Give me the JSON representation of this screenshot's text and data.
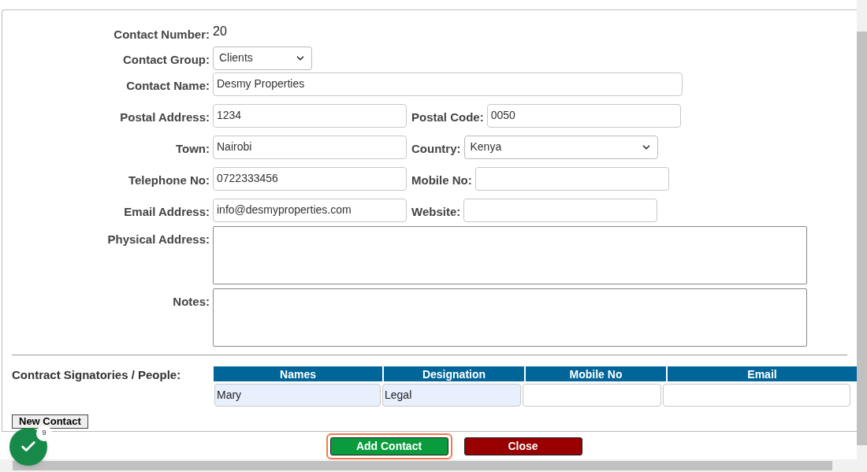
{
  "form": {
    "rows": [
      {
        "items": [
          {
            "label": "Contact Number:",
            "kind": "text",
            "value": "20"
          }
        ]
      },
      {
        "items": [
          {
            "label": "Contact Group:",
            "kind": "select",
            "value": "Clients"
          }
        ]
      },
      {
        "items": [
          {
            "label": "Contact Name:",
            "kind": "input",
            "value": "Desmy Properties"
          }
        ]
      },
      {
        "items": [
          {
            "label": "Postal Address:",
            "kind": "input",
            "value": "1234"
          },
          {
            "label": "Postal Code:",
            "kind": "input",
            "value": "0050"
          }
        ]
      },
      {
        "items": [
          {
            "label": "Town:",
            "kind": "input",
            "value": "Nairobi"
          },
          {
            "label": "Country:",
            "kind": "select",
            "value": "Kenya"
          }
        ]
      },
      {
        "items": [
          {
            "label": "Telephone No:",
            "kind": "input",
            "value": "0722333456"
          },
          {
            "label": "Mobile No:",
            "kind": "input"
          }
        ]
      },
      {
        "items": [
          {
            "label": "Email Address:",
            "kind": "input",
            "value": "info@desmyproperties.com"
          },
          {
            "label": "Website:",
            "kind": "input"
          }
        ]
      },
      {
        "items": [
          {
            "label": "Physical Address:",
            "kind": "textarea"
          }
        ]
      },
      {
        "items": [
          {
            "label": "Notes:",
            "kind": "textarea"
          }
        ]
      }
    ]
  },
  "signatories": {
    "label": "Contract Signatories / People:",
    "columns": [
      "Names",
      "Designation",
      "Mobile No",
      "Email"
    ],
    "rows": [
      {
        "cells": [
          {
            "value": "Mary",
            "autofilled": true
          },
          {
            "value": "Legal",
            "autofilled": true
          },
          {
            "autofilled": false
          },
          {
            "autofilled": false
          }
        ]
      }
    ]
  },
  "new_contact_button": "New Contact",
  "badge": {
    "count": "9"
  },
  "buttons": [
    {
      "label": "Add Contact",
      "kind": "primary",
      "focused": true
    },
    {
      "label": "Close",
      "kind": "danger",
      "focused": false
    }
  ]
}
